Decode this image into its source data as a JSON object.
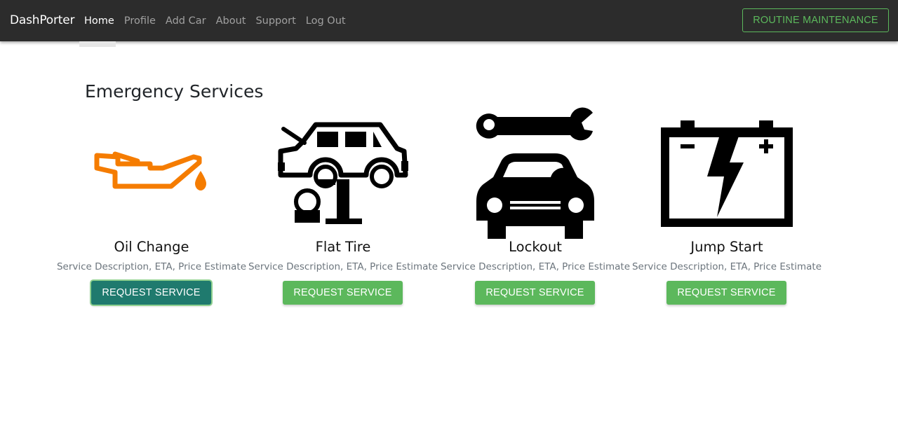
{
  "navbar": {
    "brand": "DashPorter",
    "links": [
      {
        "label": "Home",
        "active": true
      },
      {
        "label": "Profile"
      },
      {
        "label": "Add Car"
      },
      {
        "label": "About"
      },
      {
        "label": "Support"
      },
      {
        "label": "Log Out"
      }
    ],
    "routine_button": "ROUTINE MAINTENANCE"
  },
  "main": {
    "title": "Emergency Services",
    "services": [
      {
        "name": "Oil Change",
        "description": "Service Description, ETA, Price Estimate",
        "button": "REQUEST SERVICE",
        "icon": "oil-can-icon",
        "icon_color": "#f57c00"
      },
      {
        "name": "Flat Tire",
        "description": "Service Description, ETA, Price Estimate",
        "button": "REQUEST SERVICE",
        "icon": "car-lift-icon"
      },
      {
        "name": "Lockout",
        "description": "Service Description, ETA, Price Estimate",
        "button": "REQUEST SERVICE",
        "icon": "car-wrench-icon"
      },
      {
        "name": "Jump Start",
        "description": "Service Description, ETA, Price Estimate",
        "button": "REQUEST SERVICE",
        "icon": "battery-icon"
      }
    ]
  },
  "colors": {
    "navbar_bg": "#2c2c2c",
    "accent_green": "#5cb85c",
    "focused_button": "#1f7a6e"
  }
}
